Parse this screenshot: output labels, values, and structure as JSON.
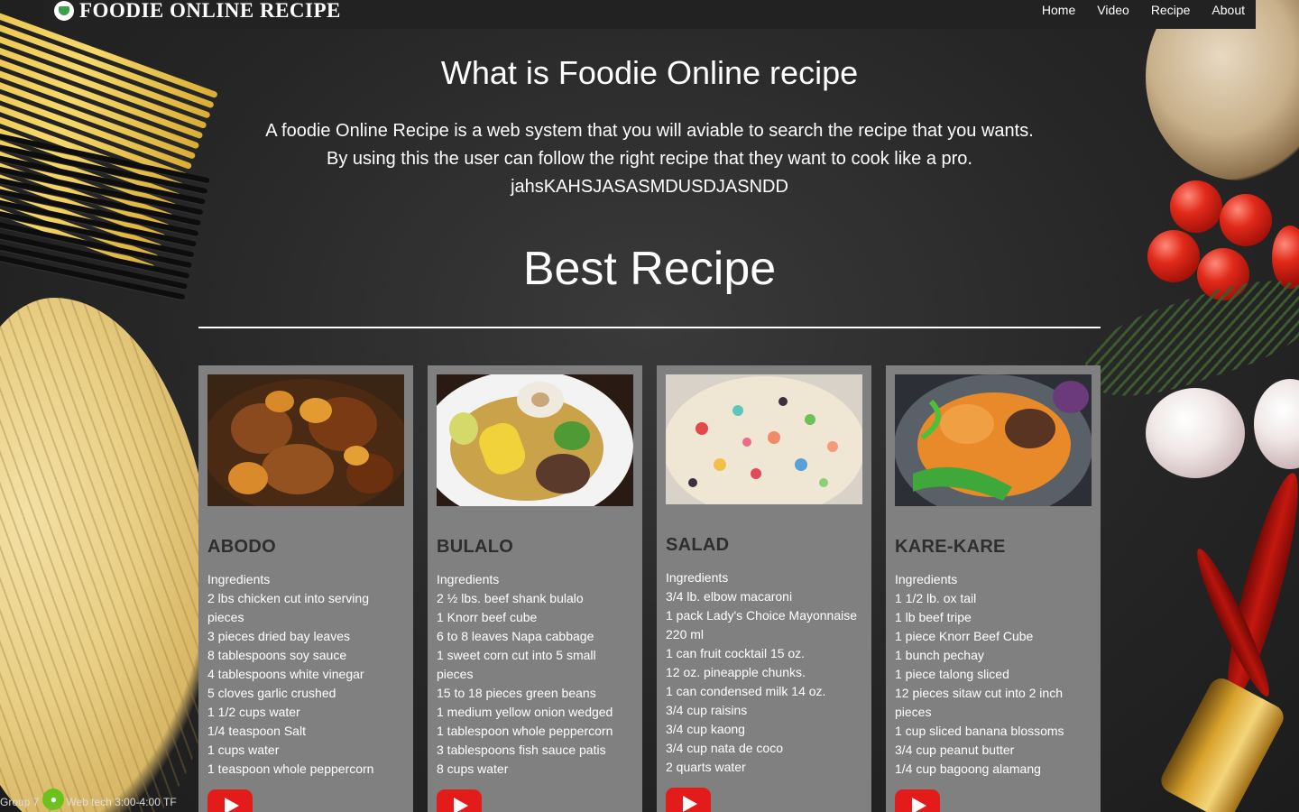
{
  "brand": {
    "name": "FOODIE ONLINE RECIPE"
  },
  "nav": {
    "links": [
      "Home",
      "Video",
      "Recipe",
      "About"
    ]
  },
  "intro": {
    "title": "What is Foodie Online recipe",
    "lines": [
      "A foodie Online Recipe is a web system that you will aviable to search the recipe that you wants.",
      "By using this the user can follow the right recipe that they want to cook like a pro.",
      "jahsKAHSJASASMDUSDJASNDD"
    ]
  },
  "section": {
    "title": "Best Recipe"
  },
  "cards": [
    {
      "title": "ABODO",
      "subtitle": "Ingredients",
      "ingredients": [
        "2 lbs chicken cut into serving pieces",
        "3 pieces dried bay leaves",
        "8 tablespoons soy sauce",
        "4 tablespoons white vinegar",
        "5 cloves garlic crushed",
        "1 1/2 cups water",
        "1/4 teaspoon Salt",
        "1 cups water",
        "1 teaspoon whole peppercorn"
      ]
    },
    {
      "title": "BULALO",
      "subtitle": "Ingredients",
      "ingredients": [
        "2 ½ lbs. beef shank bulalo",
        "1 Knorr beef cube",
        "6 to 8 leaves Napa cabbage",
        "1 sweet corn cut into 5 small pieces",
        "15 to 18 pieces green beans",
        "1 medium yellow onion wedged",
        "1 tablespoon whole peppercorn",
        "3 tablespoons fish sauce patis",
        "8 cups water"
      ]
    },
    {
      "title": "SALAD",
      "subtitle": "Ingredients",
      "ingredients": [
        "3/4 lb. elbow macaroni",
        "1 pack Lady's Choice Mayonnaise 220 ml",
        "1 can fruit cocktail 15 oz.",
        "12 oz. pineapple chunks.",
        "1 can condensed milk 14 oz.",
        "3/4 cup raisins",
        "3/4 cup kaong",
        "3/4 cup nata de coco",
        "2 quarts water"
      ]
    },
    {
      "title": "KARE-KARE",
      "subtitle": "Ingredients",
      "ingredients": [
        "1 1/2 lb. ox tail",
        "1 lb beef tripe",
        "1 piece Knorr Beef Cube",
        "1 bunch pechay",
        "1 piece talong sliced",
        "12 pieces sitaw cut into 2 inch pieces",
        "1 cup sliced banana blossoms",
        "3/4 cup peanut butter",
        "1/4 cup bagoong alamang"
      ]
    }
  ],
  "footer": {
    "left": "Group 7",
    "right": "Web tech 3:00-4:00 TF"
  },
  "colors": {
    "card_bg": "#808080",
    "nav_bg": "#222222",
    "youtube": "#e31b1b",
    "title_dark": "#2e2e2e"
  }
}
